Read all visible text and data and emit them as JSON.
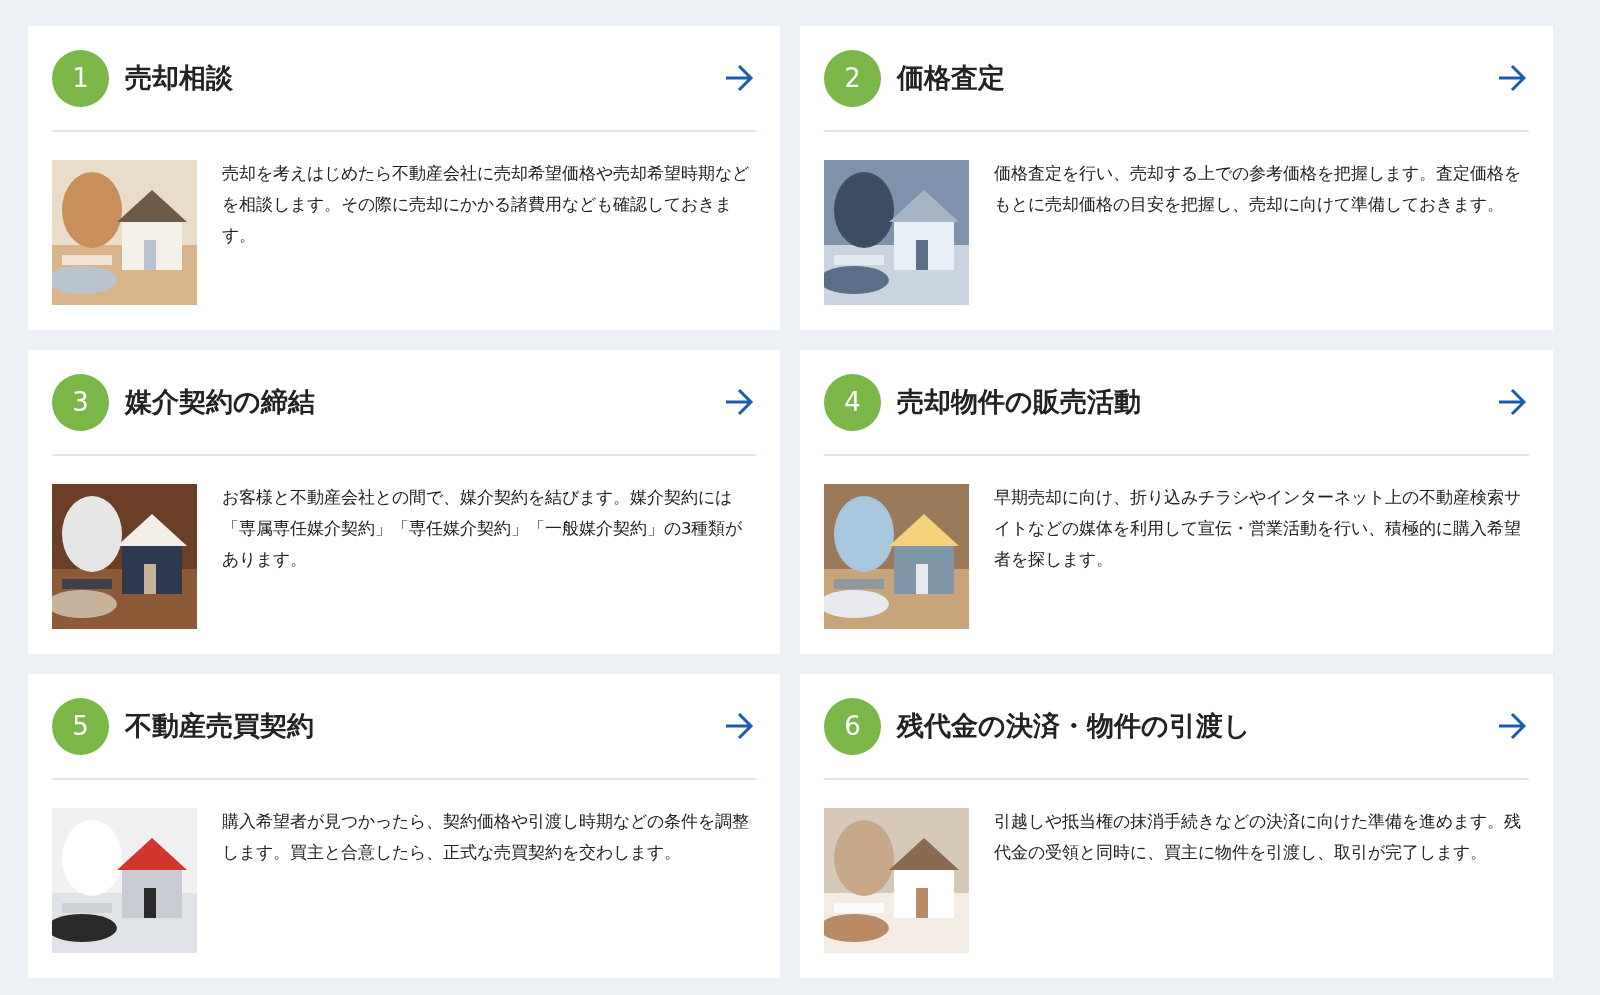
{
  "steps": [
    {
      "number": "1",
      "title": "売却相談",
      "text": "売却を考えはじめたら不動産会社に売却希望価格や売却希望時期などを相談します。その際に売却にかかる諸費用なども確認しておきます。"
    },
    {
      "number": "2",
      "title": "価格査定",
      "text": "価格査定を行い、売却する上での参考価格を把握します。査定価格をもとに売却価格の目安を把握し、売却に向けて準備しておきます。"
    },
    {
      "number": "3",
      "title": "媒介契約の締結",
      "text": "お客様と不動産会社との間で、媒介契約を結びます。媒介契約には「専属専任媒介契約」「専任媒介契約」「一般媒介契約」の3種類があります。"
    },
    {
      "number": "4",
      "title": "売却物件の販売活動",
      "text": "早期売却に向け、折り込みチラシやインターネット上の不動産検索サイトなどの媒体を利用して宣伝・営業活動を行い、積極的に購入希望者を探します。"
    },
    {
      "number": "5",
      "title": "不動産売買契約",
      "text": "購入希望者が見つかったら、契約価格や引渡し時期などの条件を調整します。買主と合意したら、正式な売買契約を交わします。"
    },
    {
      "number": "6",
      "title": "残代金の決済・物件の引渡し",
      "text": "引越しや抵当権の抹消手続きなどの決済に向けた準備を進めます。残代金の受領と同時に、買主に物件を引渡し、取引が完了します。"
    }
  ]
}
